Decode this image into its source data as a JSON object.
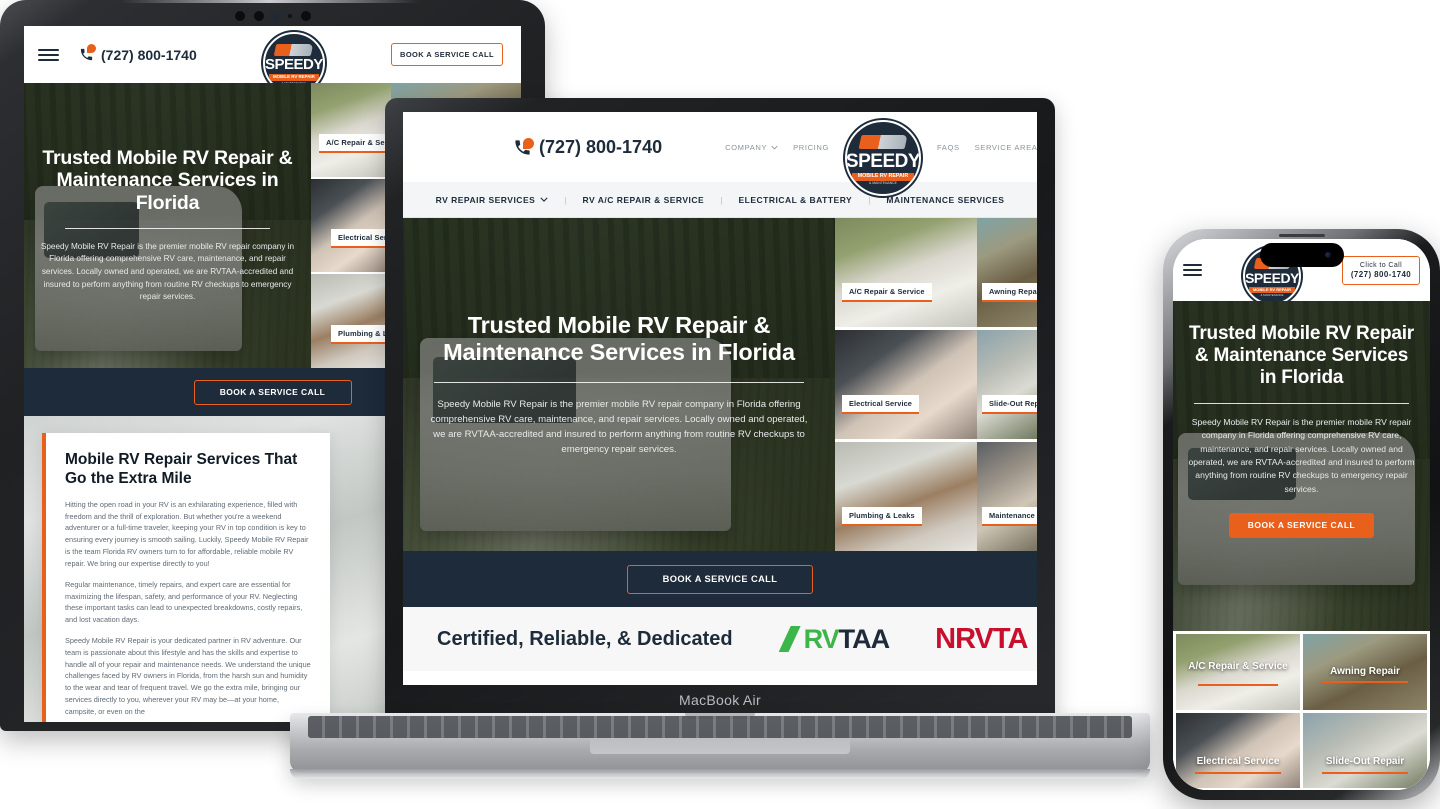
{
  "brand": {
    "name": "SPEEDY",
    "tagline": "MOBILE RV REPAIR",
    "subtagline": "& MAINTENANCE",
    "accent_color": "#e8601c",
    "dark_color": "#1d2b3a"
  },
  "phone": {
    "number": "(727) 800-1740",
    "click_to_call_label": "Click to Call"
  },
  "header": {
    "top_nav": [
      {
        "label": "COMPANY",
        "has_dropdown": true
      },
      {
        "label": "PRICING",
        "has_dropdown": false
      },
      {
        "label": "FAQS",
        "has_dropdown": false
      },
      {
        "label": "SERVICE AREAS",
        "has_dropdown": false
      }
    ],
    "cta_label": "BOOK A SERVICE CALL",
    "menu_icon": "hamburger-icon",
    "phone_icon": "phone-icon",
    "chevron_icon": "chevron-down-icon"
  },
  "service_nav": [
    {
      "label": "RV REPAIR SERVICES",
      "has_dropdown": true
    },
    {
      "label": "RV A/C REPAIR & SERVICE",
      "has_dropdown": false
    },
    {
      "label": "ELECTRICAL & BATTERY",
      "has_dropdown": false
    },
    {
      "label": "MAINTENANCE SERVICES",
      "has_dropdown": false
    }
  ],
  "hero": {
    "heading": "Trusted Mobile RV Repair & Maintenance Services in Florida",
    "heading_tablet": "Trusted Mobile RV Repair & Maintenance Services in Florida",
    "paragraph": "Speedy Mobile RV Repair is the premier mobile RV repair company in Florida offering comprehensive RV care, maintenance, and repair services. Locally owned and operated, we are RVTAA-accredited and insured to perform anything from routine RV checkups to emergency repair services.",
    "cta_label": "BOOK A SERVICE CALL"
  },
  "service_tiles": [
    {
      "label": "A/C Repair & Service",
      "photo": "ac-unit-on-rv-roof"
    },
    {
      "label": "Awning Repair",
      "photo": "rv-awning-outdoors"
    },
    {
      "label": "Electrical Service",
      "photo": "hands-repairing-wiring"
    },
    {
      "label": "Slide-Out Repair",
      "photo": "travel-trailer-slide-out"
    },
    {
      "label": "Plumbing & Leaks",
      "photo": "rv-water-heater-plumbing"
    },
    {
      "label": "Maintenance Services",
      "photo": "tools-and-maintenance"
    }
  ],
  "mobile_tiles": [
    {
      "label": "A/C Repair & Service"
    },
    {
      "label": "Awning Repair"
    },
    {
      "label": "Electrical Service"
    },
    {
      "label": "Slide-Out Repair"
    }
  ],
  "certified": {
    "title": "Certified, Reliable, & Dedicated",
    "badges": [
      {
        "name": "RVTAA",
        "part1": "RV",
        "part2": "TAA",
        "color": "#3cb54a"
      },
      {
        "name": "NRVTA",
        "text": "NRVTA",
        "color": "#c8102e"
      }
    ]
  },
  "content": {
    "heading": "Mobile RV Repair Services That Go the Extra Mile",
    "paragraphs": [
      "Hitting the open road in your RV is an exhilarating experience, filled with freedom and the thrill of exploration. But whether you're a weekend adventurer or a full-time traveler, keeping your RV in top condition is key to ensuring every journey is smooth sailing. Luckily, Speedy Mobile RV Repair is the team Florida RV owners turn to for affordable, reliable mobile RV repair. We bring our expertise directly to you!",
      "Regular maintenance, timely repairs, and expert care are essential for maximizing the lifespan, safety, and performance of your RV. Neglecting these important tasks can lead to unexpected breakdowns, costly repairs, and lost vacation days.",
      "Speedy Mobile RV Repair is your dedicated partner in RV adventure. Our team is passionate about this lifestyle and has the skills and expertise to handle all of your repair and maintenance needs. We understand the unique challenges faced by RV owners in Florida, from the harsh sun and humidity to the wear and tear of frequent travel. We go the extra mile, bringing our services directly to you, wherever your RV may be—at your home, campsite, or even on the"
    ]
  },
  "devices": {
    "laptop_label": "MacBook Air",
    "tablet_name": "tablet-device",
    "phone_name": "phone-device"
  }
}
